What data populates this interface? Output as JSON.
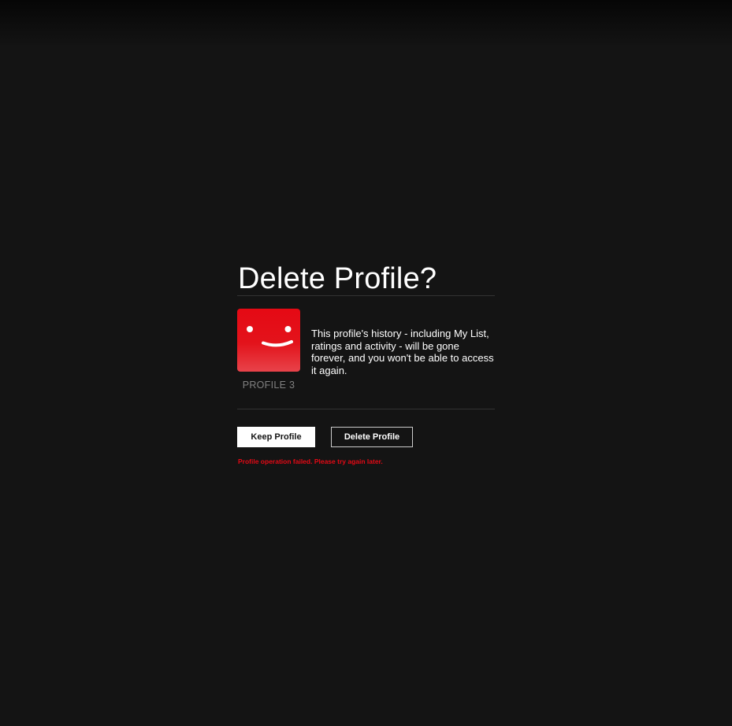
{
  "dialog": {
    "title": "Delete Profile?",
    "profile": {
      "name": "PROFILE 3",
      "avatar_color": "#e50914"
    },
    "warning": "This profile's history - including My List, ratings and activity - will be gone forever, and you won't be able to access it again.",
    "actions": {
      "keep_label": "Keep Profile",
      "delete_label": "Delete Profile"
    },
    "error": "Profile operation failed. Please try again later."
  },
  "colors": {
    "background": "#141414",
    "accent": "#e50914",
    "divider": "#333333",
    "muted_text": "#808080"
  }
}
